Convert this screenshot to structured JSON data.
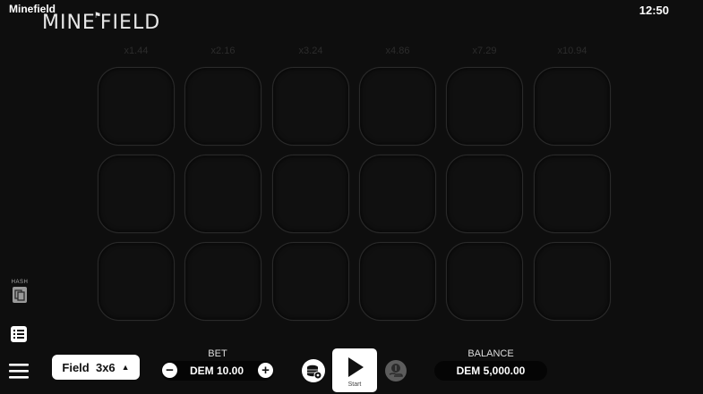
{
  "app": {
    "title": "Minefield",
    "clock": "12:50"
  },
  "logo": {
    "text_left": "MINE",
    "flag": "⚑",
    "text_right": "FIELD"
  },
  "multipliers": [
    "x1.44",
    "x2.16",
    "x3.24",
    "x4.86",
    "x7.29",
    "x10.94"
  ],
  "grid": {
    "rows": 3,
    "cols": 6
  },
  "hash": {
    "label": "HASH",
    "icon": "document-copy-icon"
  },
  "field_select": {
    "label": "Field",
    "value": "3x6",
    "caret": "▲"
  },
  "bet": {
    "label": "BET",
    "value": "DEM 10.00",
    "minus": "−",
    "plus": "+"
  },
  "start": {
    "label": "Start"
  },
  "balance": {
    "label": "BALANCE",
    "value": "DEM 5,000.00"
  }
}
